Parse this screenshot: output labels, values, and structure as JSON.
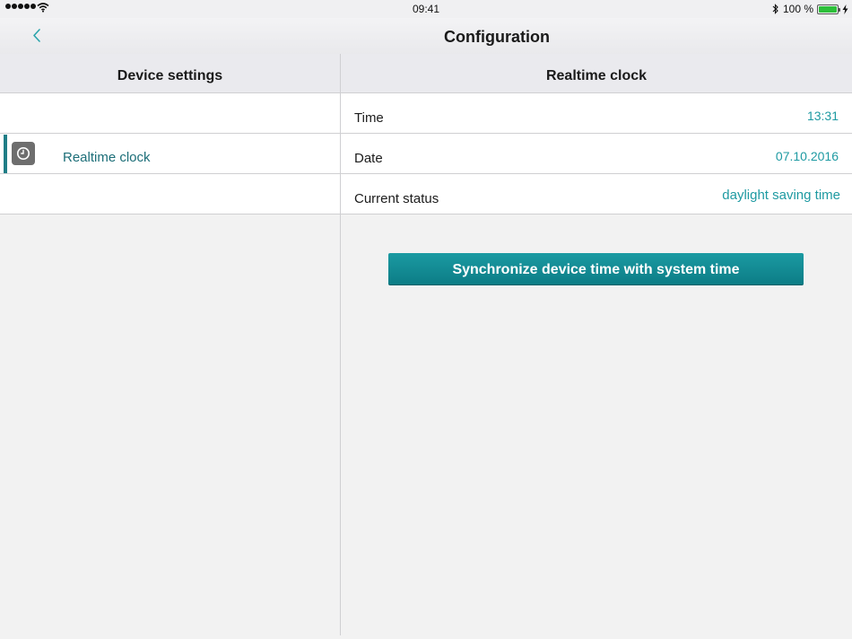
{
  "status_bar": {
    "time": "09:41",
    "battery_text": "100 %",
    "battery_level": 1.0
  },
  "nav": {
    "title": "Configuration",
    "back_icon": "chevron-left-icon"
  },
  "left_pane": {
    "header": "Device settings",
    "items": [
      {
        "label": "",
        "icon": ""
      },
      {
        "label": "Realtime clock",
        "icon": "clock-icon",
        "selected": true
      },
      {
        "label": "",
        "icon": ""
      }
    ]
  },
  "right_pane": {
    "header": "Realtime clock",
    "rows": [
      {
        "label": "Time",
        "value": "13:31"
      },
      {
        "label": "Date",
        "value": "07.10.2016"
      },
      {
        "label": "Current status",
        "value": "daylight saving time"
      }
    ],
    "sync_button_label": "Synchronize device time with system time"
  },
  "colors": {
    "accent": "#1e9aa2",
    "selected_bar": "#1f7d86",
    "button_top": "#1b9aa2",
    "button_bottom": "#0c7d86",
    "battery": "#2dbf3a"
  }
}
